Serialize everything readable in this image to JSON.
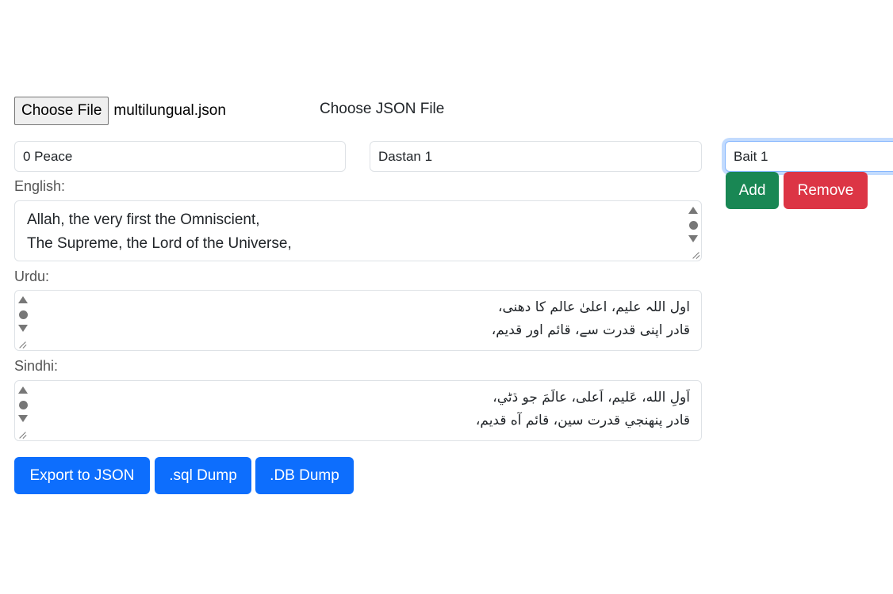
{
  "file": {
    "choose_button": "Choose File",
    "file_name": "multilungual.json",
    "label": "Choose JSON File"
  },
  "inputs": {
    "first": "0 Peace",
    "second": "Dastan 1",
    "third": "Bait 1"
  },
  "actions": {
    "add": "Add",
    "remove": "Remove"
  },
  "english": {
    "label": "English:",
    "lines": [
      "Allah, the very first the Omniscient,",
      "The Supreme, the Lord of the Universe,"
    ]
  },
  "urdu": {
    "label": "Urdu:",
    "lines": [
      "اول اللہ علیم، اعلیٰ عالم کا دھنی،",
      "قادر اپنی قدرت سے، قائم اور قدیم،"
    ]
  },
  "sindhi": {
    "label": "Sindhi:",
    "lines": [
      "اَولِ الله، عَليم، اَعلى، عالَمَ جو ڌڻي،",
      "قادر پنهنجي قدرت سين، قائم آه قديم،"
    ]
  },
  "export": {
    "json": "Export to JSON",
    "sql": ".sql Dump",
    "db": ".DB Dump"
  },
  "colors": {
    "primary": "#0d6efd",
    "success": "#198754",
    "danger": "#dc3545"
  }
}
